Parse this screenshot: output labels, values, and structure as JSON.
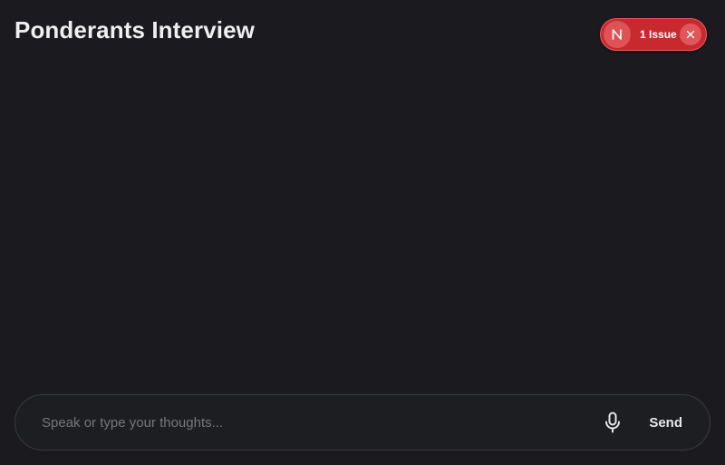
{
  "header": {
    "title": "Ponderants Interview"
  },
  "issues_indicator": {
    "badge_letter": "N",
    "label": "1 Issue",
    "close_icon": "close-icon",
    "color": "#c8292f"
  },
  "composer": {
    "placeholder": "Speak or type your thoughts...",
    "value": "",
    "mic_icon": "microphone-icon",
    "send_label": "Send"
  }
}
